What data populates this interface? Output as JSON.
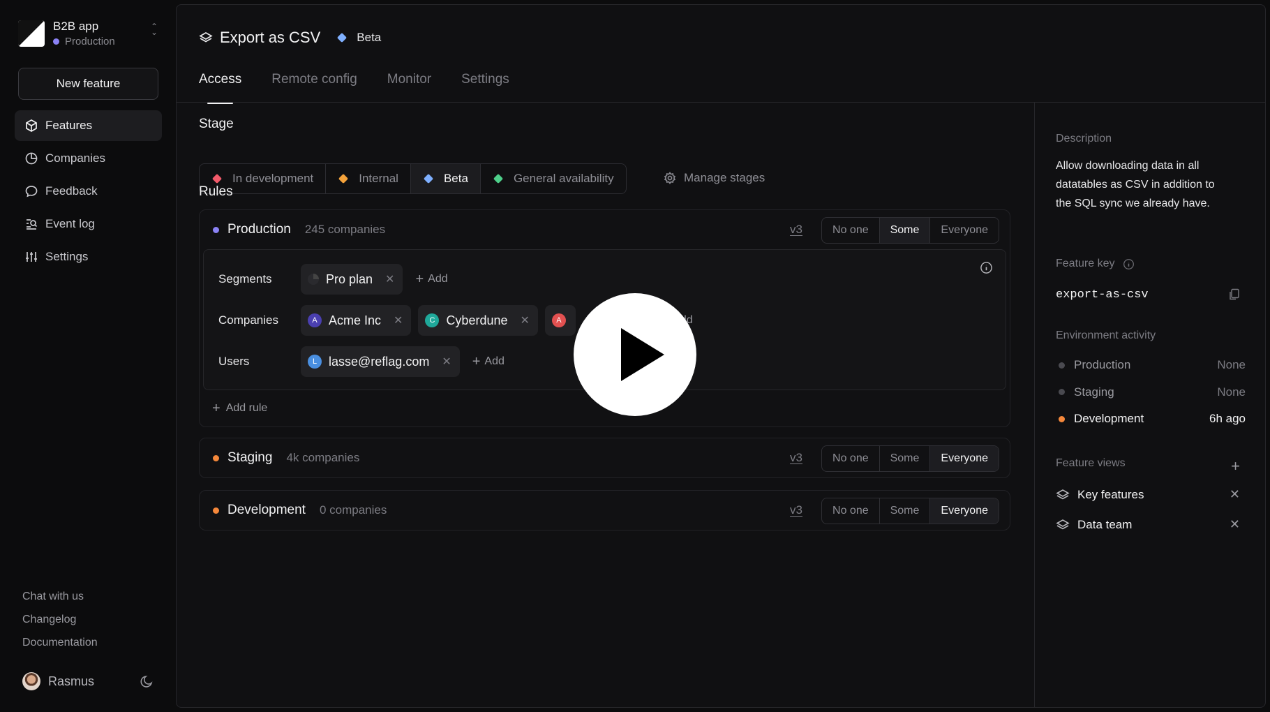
{
  "app": {
    "name": "B2B app",
    "environment": "Production"
  },
  "sidebar": {
    "new_feature_label": "New feature",
    "items": [
      {
        "label": "Features",
        "icon": "cube-icon",
        "active": true
      },
      {
        "label": "Companies",
        "icon": "pie-chart-icon"
      },
      {
        "label": "Feedback",
        "icon": "chat-bubble-icon"
      },
      {
        "label": "Event log",
        "icon": "search-list-icon"
      },
      {
        "label": "Settings",
        "icon": "sliders-icon"
      }
    ],
    "footer_links": [
      "Chat with us",
      "Changelog",
      "Documentation"
    ],
    "user": {
      "name": "Rasmus"
    }
  },
  "feature": {
    "title": "Export as CSV",
    "stage": "Beta",
    "tabs": [
      "Access",
      "Remote config",
      "Monitor",
      "Settings"
    ],
    "active_tab": "Access"
  },
  "stage_section": {
    "label": "Stage",
    "stages": [
      {
        "label": "In development",
        "color": "#f25a6a"
      },
      {
        "label": "Internal",
        "color": "#f5a33b"
      },
      {
        "label": "Beta",
        "color": "#7fb0ff",
        "active": true
      },
      {
        "label": "General availability",
        "color": "#4ed08a"
      }
    ],
    "manage_label": "Manage stages"
  },
  "rules": {
    "label": "Rules",
    "environments": [
      {
        "name": "Production",
        "count": "245 companies",
        "version": "v3",
        "color": "#8b82f5",
        "options": [
          "No one",
          "Some",
          "Everyone"
        ],
        "selected": "Some",
        "segments_label": "Segments",
        "segments": [
          "Pro plan"
        ],
        "companies_label": "Companies",
        "companies": [
          {
            "letter": "A",
            "name": "Acme Inc",
            "color": "#4a3fb0"
          },
          {
            "letter": "C",
            "name": "Cyberdune",
            "color": "#1fa89a"
          },
          {
            "letter": "A",
            "name": "",
            "color": "#e25050"
          }
        ],
        "users_label": "Users",
        "users": [
          {
            "letter": "L",
            "name": "lasse@reflag.com",
            "color": "#4a8fe0"
          }
        ],
        "add_label": "Add",
        "add_partial": "dd",
        "add_rule_label": "Add rule"
      },
      {
        "name": "Staging",
        "count": "4k companies",
        "version": "v3",
        "color": "#f5883b",
        "options": [
          "No one",
          "Some",
          "Everyone"
        ],
        "selected": "Everyone"
      },
      {
        "name": "Development",
        "count": "0 companies",
        "version": "v3",
        "color": "#f5883b",
        "options": [
          "No one",
          "Some",
          "Everyone"
        ],
        "selected": "Everyone"
      }
    ]
  },
  "details": {
    "description_label": "Description",
    "description": "Allow downloading data in all datatables as CSV in addition to the SQL sync we already have.",
    "feature_key_label": "Feature key",
    "feature_key": "export-as-csv",
    "activity_label": "Environment activity",
    "activity": [
      {
        "env": "Production",
        "value": "None",
        "color": "#4a4a50"
      },
      {
        "env": "Staging",
        "value": "None",
        "color": "#4a4a50"
      },
      {
        "env": "Development",
        "value": "6h ago",
        "color": "#f5883b"
      }
    ],
    "views_label": "Feature views",
    "views": [
      "Key features",
      "Data team"
    ]
  }
}
